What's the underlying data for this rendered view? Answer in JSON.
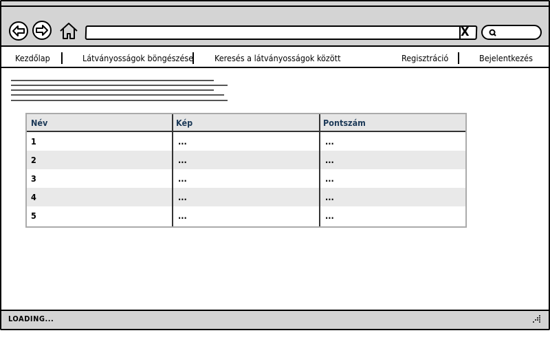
{
  "browser": {
    "back_icon": "back-arrow-icon",
    "forward_icon": "forward-arrow-icon",
    "home_icon": "home-icon",
    "url_value": "",
    "clear_glyph": "X",
    "search_icon": "search-icon",
    "search_value": ""
  },
  "nav": {
    "home": "Kezdőlap",
    "browse": "Látványosságok böngészése",
    "search": "Keresés a látványosságok között",
    "register": "Regisztráció",
    "login": "Bejelentkezés"
  },
  "table": {
    "columns": [
      "Név",
      "Kép",
      "Pontszám"
    ],
    "rows": [
      [
        "1",
        "...",
        "..."
      ],
      [
        "2",
        "...",
        "..."
      ],
      [
        "3",
        "...",
        "..."
      ],
      [
        "4",
        "...",
        "..."
      ],
      [
        "5",
        "...",
        "..."
      ]
    ]
  },
  "status": {
    "text": "LOADING..."
  },
  "colors": {
    "chrome_gray": "#d4d4d4",
    "header_text": "#1d3a58",
    "row_alt": "#e9e9e9"
  }
}
